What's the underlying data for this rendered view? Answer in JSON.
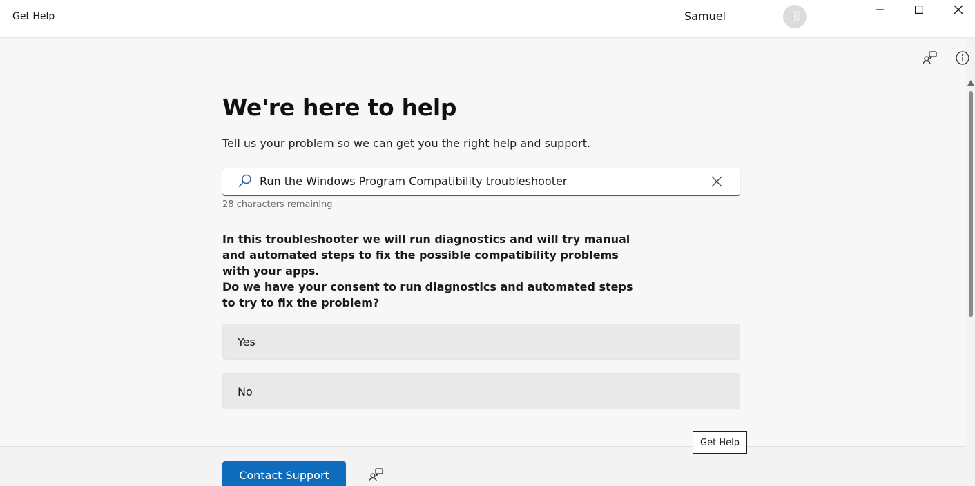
{
  "window": {
    "app_title": "Get Help",
    "user_name": "Samuel",
    "avatar_initial": "S",
    "controls": [
      "minimize",
      "maximize",
      "close"
    ]
  },
  "toolbar_icons": [
    "feedback-icon",
    "info-icon"
  ],
  "main": {
    "headline": "We're here to help",
    "subtitle": "Tell us your problem so we can get you the right help and support.",
    "search": {
      "value": "Run the Windows Program Compatibility troubleshooter",
      "char_remaining": "28 characters remaining"
    },
    "paragraph1": "In this troubleshooter we will run diagnostics and will try manual and automated steps to fix the possible compatibility problems with your apps.",
    "paragraph2": "Do we have your consent to run diagnostics and automated steps to try to fix the problem?",
    "options": {
      "yes": "Yes",
      "no": "No"
    }
  },
  "tooltip": "Get Help",
  "footer": {
    "contact_support": "Contact Support"
  },
  "colors": {
    "accent": "#0f6cbd",
    "background": "#f7f7f7",
    "option_bg": "#e9e9e9"
  }
}
